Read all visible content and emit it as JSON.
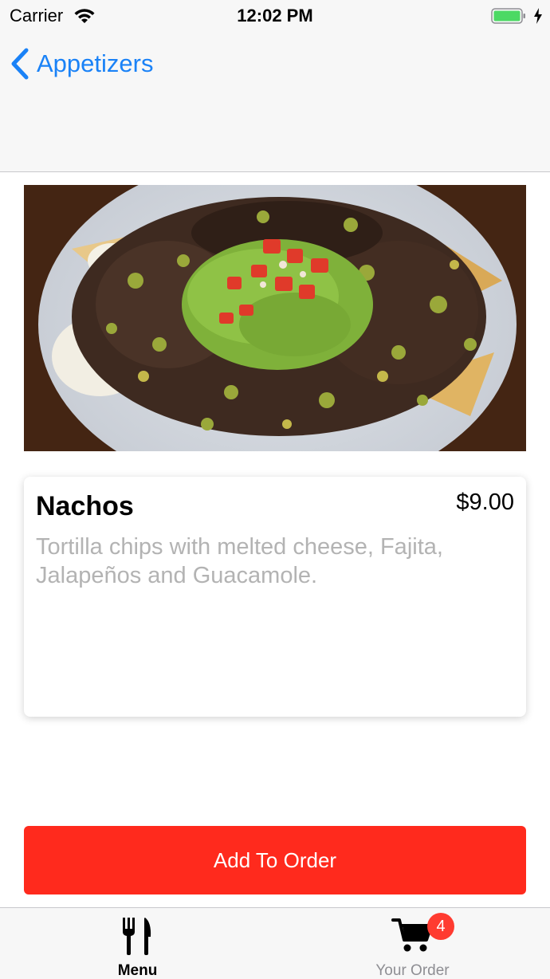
{
  "status_bar": {
    "carrier": "Carrier",
    "time": "12:02 PM",
    "wifi_icon": "wifi-icon",
    "battery_icon": "battery-icon",
    "battery_color": "#4cd964"
  },
  "nav": {
    "back_label": "Appetizers",
    "back_icon": "chevron-left-icon",
    "accent_color": "#1a82f7"
  },
  "item": {
    "name": "Nachos",
    "price": "$9.00",
    "description": "Tortilla chips with melted cheese, Fajita, Jalapeños and Guacamole."
  },
  "actions": {
    "add_label": "Add To Order",
    "button_color": "#ff2a1d"
  },
  "tab_bar": {
    "tabs": [
      {
        "label": "Menu",
        "icon": "fork-knife-icon",
        "selected": true
      },
      {
        "label": "Your Order",
        "icon": "cart-icon",
        "badge": "4",
        "selected": false
      }
    ]
  }
}
